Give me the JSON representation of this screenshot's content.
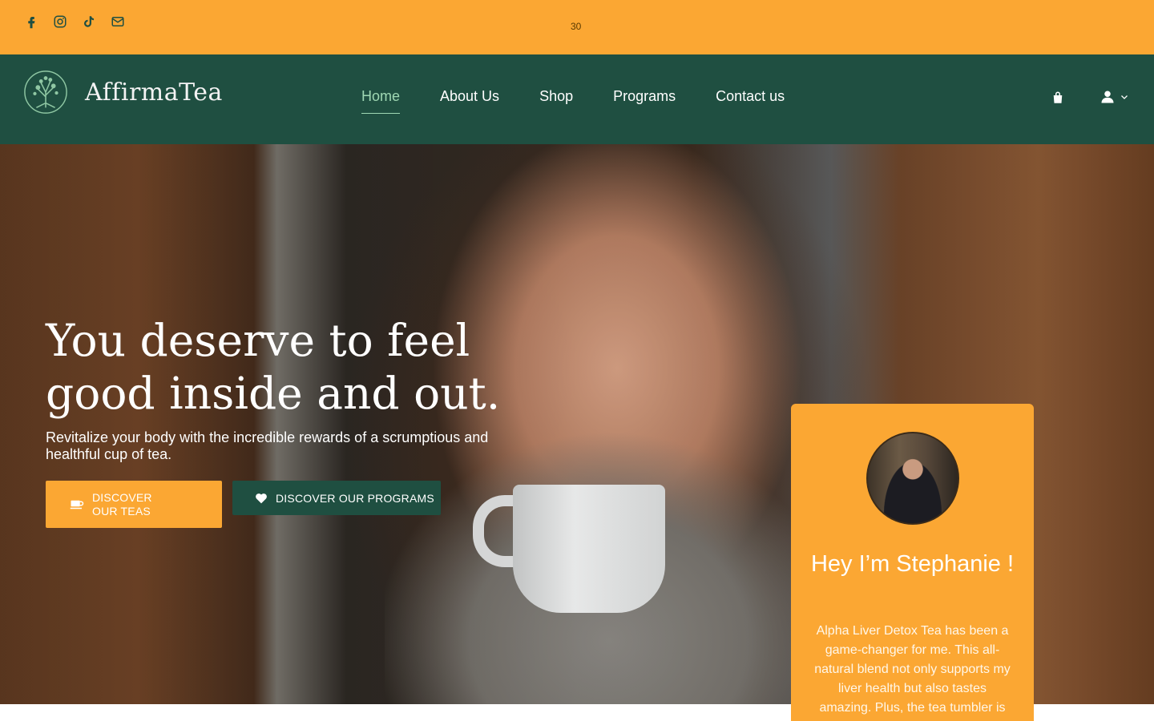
{
  "topbar": {
    "social_icons": [
      "facebook-icon",
      "instagram-icon",
      "tiktok-icon",
      "mail-icon"
    ],
    "center_text": "30"
  },
  "header": {
    "brand": "AffirmaTea",
    "nav": [
      {
        "label": "Home",
        "active": true
      },
      {
        "label": "About Us",
        "active": false
      },
      {
        "label": "Shop",
        "active": false
      },
      {
        "label": "Programs",
        "active": false
      },
      {
        "label": "Contact us",
        "active": false
      }
    ],
    "icons": [
      "shopping-bag-icon",
      "user-icon",
      "chevron-down-icon"
    ]
  },
  "hero": {
    "headline": "You deserve to feel good inside and out.",
    "subline": "Revitalize your body with the incredible rewards of a scrumptious and healthful cup of tea.",
    "btn_teas": "DISCOVER OUR TEAS",
    "btn_programs": "DISCOVER OUR PROGRAMS"
  },
  "testimonial": {
    "title": "Hey I’m Stephanie !",
    "quote": "Alpha Liver Detox Tea has been a game-changer for me. This all-natural blend not only supports my liver health but also tastes amazing. Plus, the tea tumbler is"
  },
  "colors": {
    "accent_orange": "#FBA733",
    "dark_green": "#1F4F41",
    "nav_active": "#9fd7b3"
  }
}
